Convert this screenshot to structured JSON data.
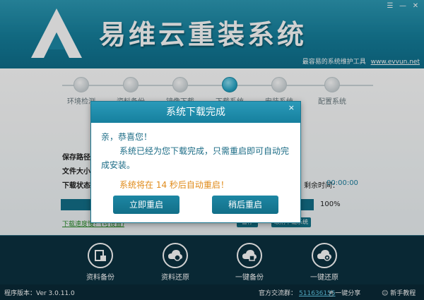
{
  "window": {
    "title": "易维云重装系统",
    "slogan": "最容易的系统维护工具",
    "url": "www.evvun.net"
  },
  "steps": [
    {
      "label": "环境检测",
      "active": false
    },
    {
      "label": "资料备份",
      "active": false
    },
    {
      "label": "镜像下载",
      "active": false
    },
    {
      "label": "下载系统",
      "active": true
    },
    {
      "label": "安装系统",
      "active": false
    },
    {
      "label": "配置系统",
      "active": false
    }
  ],
  "download": {
    "save_path_label": "保存路径：",
    "file_size_label": "文件大小：",
    "status_label": "下载状态：",
    "time_label": "剩余时间：",
    "time_value": "00:00:00",
    "progress_percent": 100,
    "progress_text": "100%",
    "speed_link": "下载速度慢？(可设置)",
    "btn_pause": "暂停",
    "btn_cancel": "取消下载系统"
  },
  "toolbar": {
    "items": [
      {
        "label": "资料备份",
        "icon": "backup-icon"
      },
      {
        "label": "资料还原",
        "icon": "restore-icon"
      },
      {
        "label": "一键备份",
        "icon": "one-click-backup-icon"
      },
      {
        "label": "一键还原",
        "icon": "one-click-restore-icon"
      }
    ]
  },
  "status": {
    "version": "程序版本：Ver 3.0.11.0",
    "group_label": "官方交流群：",
    "group_number": "511636155",
    "share": "一键分享",
    "tutorial": "新手教程"
  },
  "dialog": {
    "title": "系统下载完成",
    "close": "×",
    "greeting": "亲，恭喜您！",
    "message": "系统已经为您下载完成，只需重启即可自动完成安装。",
    "countdown_prefix": "系统将在 ",
    "countdown_value": "14",
    "countdown_suffix": " 秒后自动重启！",
    "btn_restart_now": "立即重启",
    "btn_restart_later": "稍后重启"
  }
}
